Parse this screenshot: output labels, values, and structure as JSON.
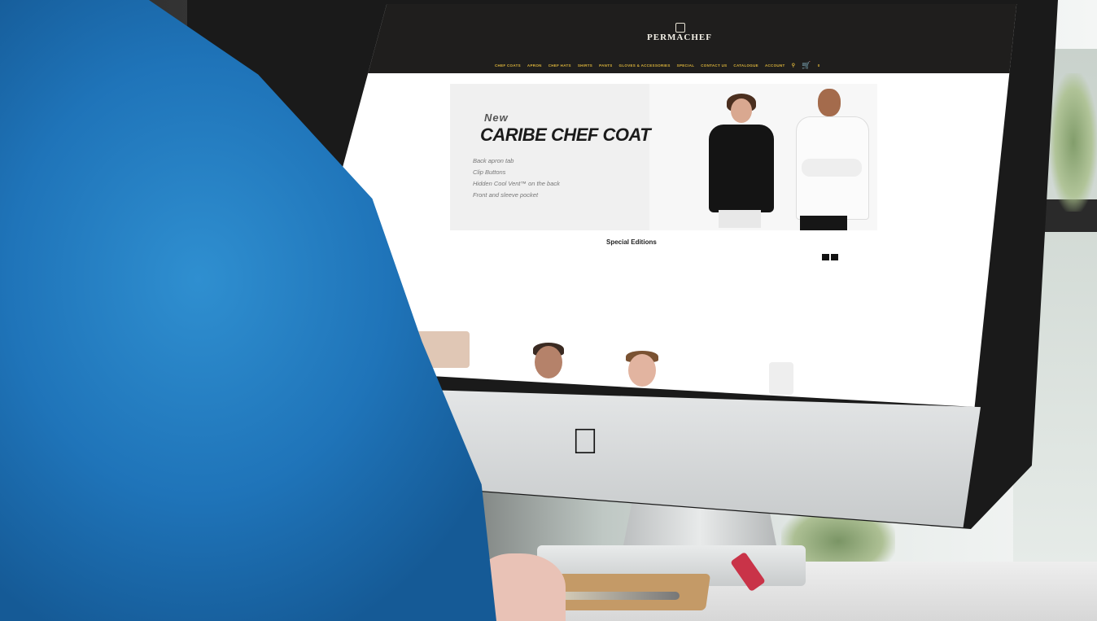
{
  "site": {
    "brand": "PERMACHEF",
    "nav": [
      "CHEF COATS",
      "APRON",
      "CHEF HATS",
      "SHIRTS",
      "PANTS",
      "GLOVES & ACCESSORIES",
      "SPECIAL",
      "CONTACT US",
      "CATALOGUE",
      "ACCOUNT"
    ],
    "cart_count": "0"
  },
  "hero": {
    "kicker": "New",
    "title": "CARIBE CHEF COAT",
    "features": [
      "Back apron tab",
      "Clip Buttons",
      "Hidden Cool Vent™ on the back",
      "Front and sleeve pocket"
    ]
  },
  "section": {
    "title": "Special Editions"
  },
  "colors": {
    "topbar": "#1f1e1d",
    "accent": "#d9b23a",
    "shirt": "#1f74b9"
  }
}
